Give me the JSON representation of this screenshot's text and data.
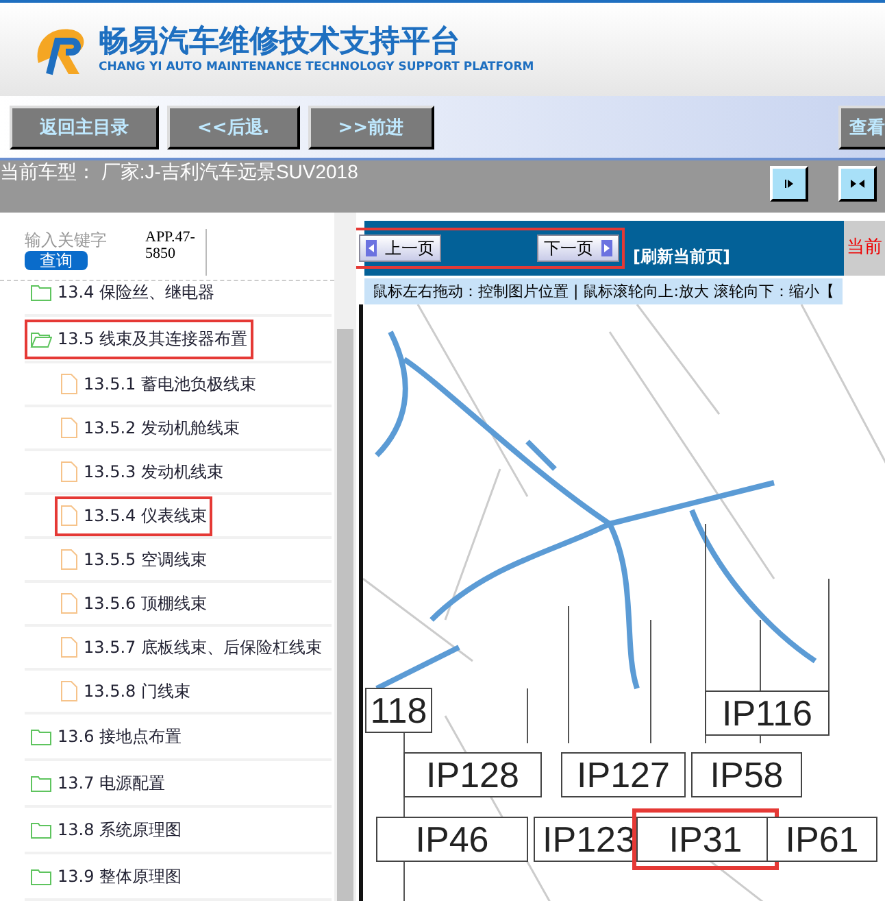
{
  "header": {
    "title": "畅易汽车维修技术支持平台",
    "subtitle": "CHANG YI AUTO MAINTENANCE TECHNOLOGY SUPPORT PLATFORM"
  },
  "toolbar": {
    "buttons": [
      "返回主目录",
      "<<后退.",
      ">>前进"
    ],
    "right_button": "查看"
  },
  "car_bar": {
    "text": "当前车型： 厂家:J-吉利汽车远景SUV2018"
  },
  "search": {
    "placeholder": "输入关键字",
    "button": "查询",
    "code": "APP.47-5850"
  },
  "tree": [
    {
      "kind": "folder",
      "label": "13.4 保险丝、继电器",
      "expanded": false,
      "highlighted": false
    },
    {
      "kind": "folder",
      "label": "13.5 线束及其连接器布置",
      "expanded": true,
      "highlighted": true,
      "children": [
        {
          "kind": "file",
          "label": "13.5.1 蓄电池负极线束",
          "highlighted": false
        },
        {
          "kind": "file",
          "label": "13.5.2 发动机舱线束",
          "highlighted": false
        },
        {
          "kind": "file",
          "label": "13.5.3 发动机线束",
          "highlighted": false
        },
        {
          "kind": "file",
          "label": "13.5.4 仪表线束",
          "highlighted": true
        },
        {
          "kind": "file",
          "label": "13.5.5 空调线束",
          "highlighted": false
        },
        {
          "kind": "file",
          "label": "13.5.6 顶棚线束",
          "highlighted": false
        },
        {
          "kind": "file",
          "label": "13.5.7 底板线束、后保险杠线束",
          "highlighted": false
        },
        {
          "kind": "file",
          "label": "13.5.8 门线束",
          "highlighted": false
        }
      ]
    },
    {
      "kind": "folder",
      "label": "13.6 接地点布置",
      "expanded": false,
      "highlighted": false
    },
    {
      "kind": "folder",
      "label": "13.7 电源配置",
      "expanded": false,
      "highlighted": false
    },
    {
      "kind": "folder",
      "label": "13.8 系统原理图",
      "expanded": false,
      "highlighted": false
    },
    {
      "kind": "folder",
      "label": "13.9 整体原理图",
      "expanded": false,
      "highlighted": false
    }
  ],
  "pager": {
    "prev": "上一页",
    "next": "下一页",
    "refresh": "[刷新当前页]",
    "current": "当前",
    "highlighted": true
  },
  "hint": "鼠标左右拖动：控制图片位置 | 鼠标滚轮向上:放大  滚轮向下：缩小【",
  "diagram": {
    "connectors": [
      {
        "label": "118",
        "highlighted": false
      },
      {
        "label": "IP116",
        "highlighted": false
      },
      {
        "label": "IP128",
        "highlighted": false
      },
      {
        "label": "IP127",
        "highlighted": false
      },
      {
        "label": "IP58",
        "highlighted": false
      },
      {
        "label": "IP46",
        "highlighted": false
      },
      {
        "label": "IP123",
        "highlighted": false
      },
      {
        "label": "IP31",
        "highlighted": true
      },
      {
        "label": "IP61",
        "highlighted": false
      }
    ]
  }
}
